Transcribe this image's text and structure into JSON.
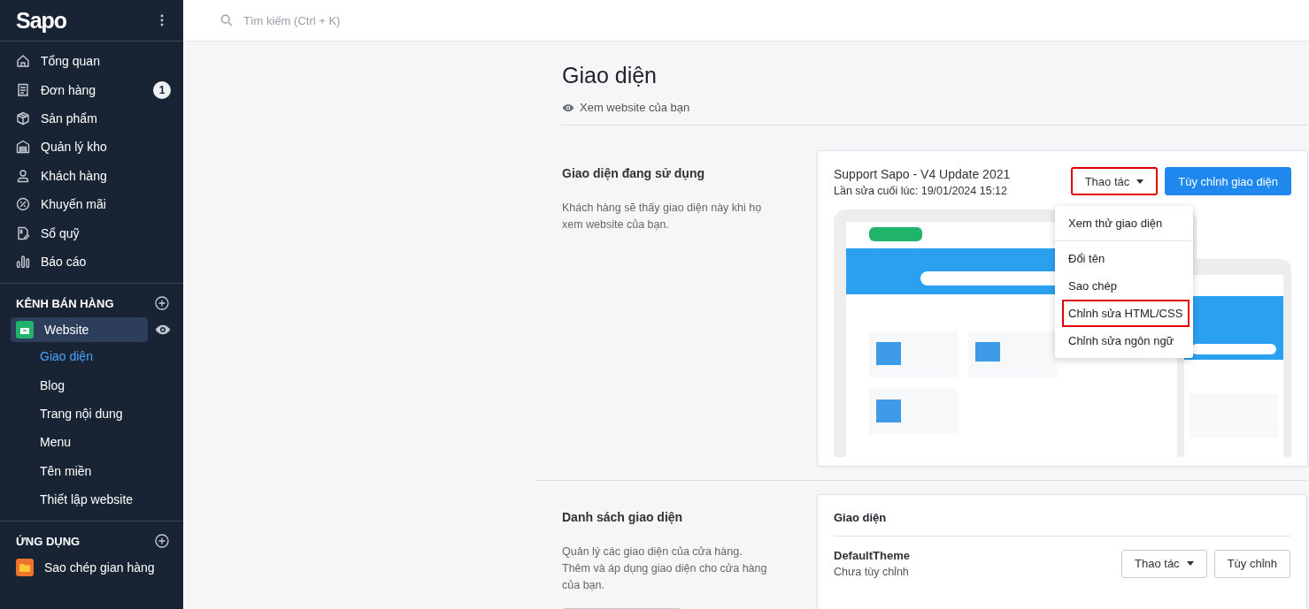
{
  "sidebar": {
    "logo": "Sapo",
    "nav": [
      {
        "label": "Tổng quan",
        "selected": false
      },
      {
        "label": "Đơn hàng",
        "selected": false,
        "badge": "1"
      },
      {
        "label": "Sản phẩm",
        "selected": false
      },
      {
        "label": "Quản lý kho",
        "selected": false
      },
      {
        "label": "Khách hàng",
        "selected": false
      },
      {
        "label": "Khuyến mãi",
        "selected": false
      },
      {
        "label": "Sổ quỹ",
        "selected": false
      },
      {
        "label": "Báo cáo",
        "selected": false
      }
    ],
    "sections": [
      {
        "title": "KÊNH BÁN HÀNG",
        "items": [
          {
            "label": "Website",
            "selected": true,
            "children": [
              {
                "label": "Giao diện",
                "selected": true
              },
              {
                "label": "Blog",
                "selected": false
              },
              {
                "label": "Trang nội dung",
                "selected": false
              },
              {
                "label": "Menu",
                "selected": false
              },
              {
                "label": "Tên miền",
                "selected": false
              },
              {
                "label": "Thiết lập website",
                "selected": false
              }
            ]
          }
        ]
      },
      {
        "title": "ỨNG DỤNG",
        "items": [
          {
            "label": "Sao chép gian hàng",
            "selected": false
          }
        ]
      }
    ]
  },
  "search": {
    "placeholder": "Tìm kiếm (Ctrl + K)"
  },
  "page": {
    "title": "Giao diện",
    "view_link": "Xem website của bạn"
  },
  "current_theme": {
    "heading": "Giao diện đang sử dụng",
    "description": "Khách hàng sẽ thấy giao diện này khi họ xem website của bạn.",
    "name": "Support Sapo - V4 Update 2021",
    "edited": "Lần sửa cuối lúc: 19/01/2024 15:12",
    "actions_button": {
      "label": "Thao tác",
      "highlighted": true
    },
    "customize_button": "Tùy chỉnh giao diện",
    "preview": {
      "kind": "picture"
    },
    "menu_groups": [
      [
        {
          "label": "Xem thử giao diện",
          "highlighted": false
        }
      ],
      [
        {
          "label": "Đổi tên",
          "highlighted": false
        },
        {
          "label": "Sao chép",
          "highlighted": false
        },
        {
          "label": "Chỉnh sửa HTML/CSS",
          "highlighted": true
        },
        {
          "label": "Chỉnh sửa ngôn ngữ",
          "highlighted": false
        }
      ]
    ]
  },
  "theme_list": {
    "heading": "Danh sách giao diện",
    "description": "Quản lý các giao diện của cửa hàng. Thêm và áp dụng giao diện cho cửa hàng của bạn.",
    "card_title": "Giao diện",
    "themes": [
      {
        "name": "DefaultTheme",
        "status": "Chưa tùy chỉnh",
        "actions_button": "Thao tác",
        "customize_button": "Tùy chỉnh"
      }
    ]
  }
}
